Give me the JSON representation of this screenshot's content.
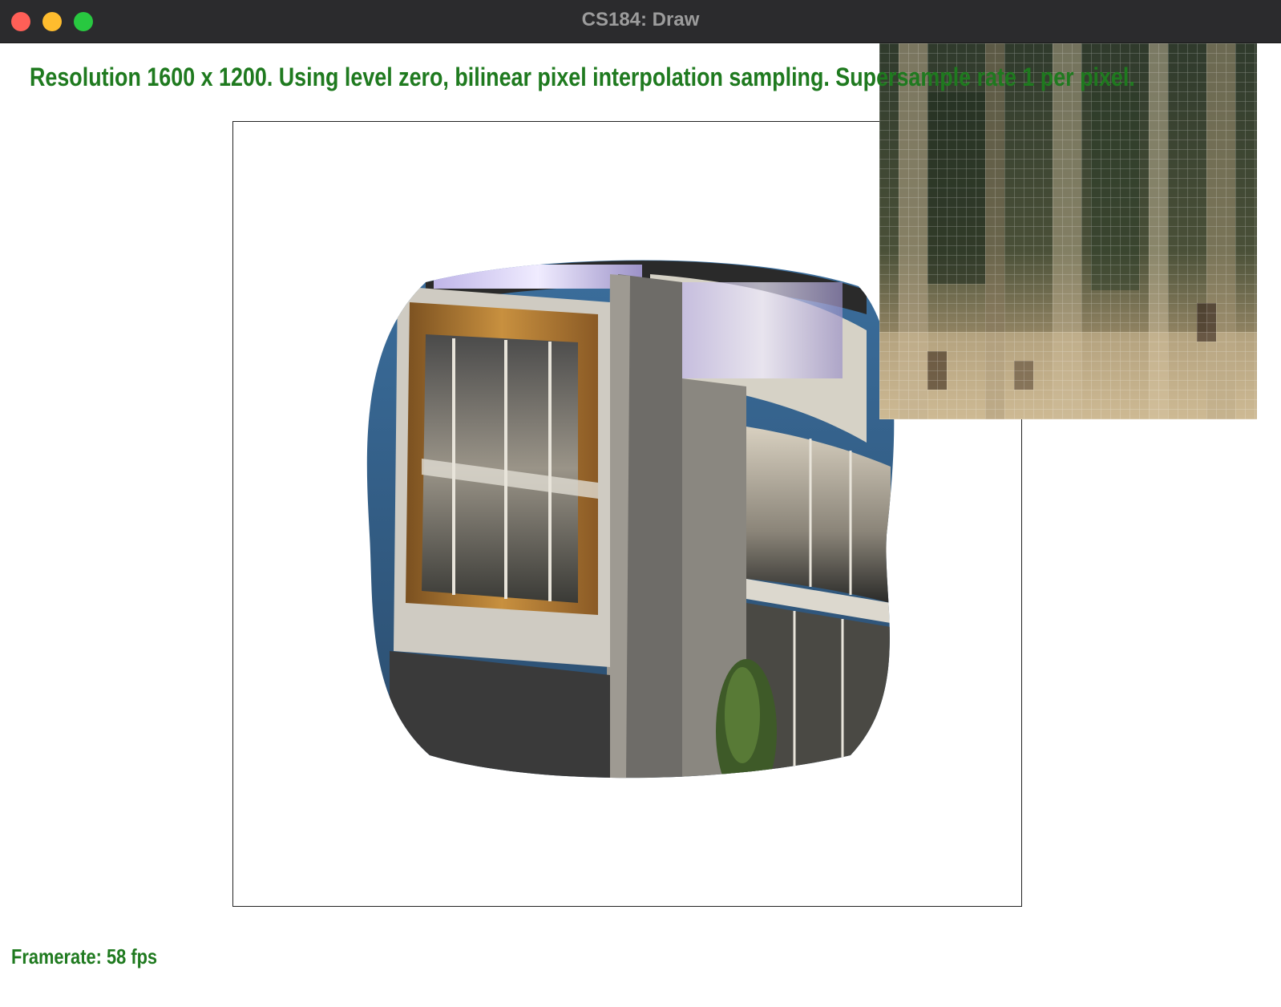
{
  "window": {
    "title": "CS184: Draw"
  },
  "status": {
    "line": "Resolution 1600 x 1200. Using level zero, bilinear pixel interpolation sampling. Supersample rate 1 per pixel.",
    "framerate": "Framerate: 58 fps"
  },
  "colors": {
    "status_text": "#1f7a1f",
    "titlebar": "#2b2b2d",
    "close": "#ff5f57",
    "minimize": "#febc2e",
    "maximize": "#28c840"
  }
}
